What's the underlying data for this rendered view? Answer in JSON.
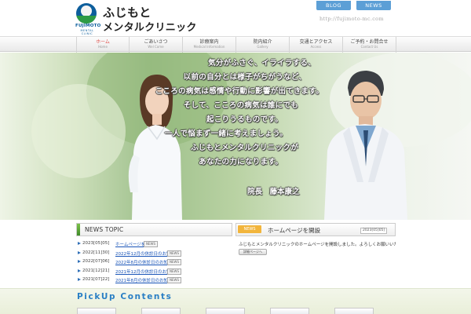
{
  "header": {
    "logo_jp_line1": "ふじもと",
    "logo_jp_line2": "メンタルクリニック",
    "logo_en": "FUJIMOTO",
    "logo_en_sub": "MENTAL CLINIC",
    "blog_label": "BLOG",
    "news_label": "NEWS",
    "site_url": "http://fujimoto-mc.com"
  },
  "nav": {
    "items": [
      {
        "jp": "ホーム",
        "en": "Home"
      },
      {
        "jp": "ごあいさつ",
        "en": "Wel Come"
      },
      {
        "jp": "診療案内",
        "en": "Medical Information"
      },
      {
        "jp": "院内紹介",
        "en": "Gallery"
      },
      {
        "jp": "交通とアクセス",
        "en": "Access"
      },
      {
        "jp": "ご予約・お問合せ",
        "en": "Contact Us"
      }
    ]
  },
  "hero": {
    "lines": [
      "気分がふさぐ、イライラする、",
      "以前の自分とは様子がちがうなど、",
      "こころの病気は感情や行動に影響が出てきます。",
      "そして、こころの病気は誰にでも",
      "起こりうるものです。",
      "一人で悩まず一緒に考えましょう。",
      "ふじもとメンタルクリニックが",
      "あなたの力になります。"
    ],
    "signature": "院長　藤本康之"
  },
  "news_topic": {
    "title": "NEWS TOPIC",
    "items": [
      {
        "date": "2023[05]05]",
        "title": "ホームページを開設",
        "badge": "NEWS"
      },
      {
        "date": "2022[11]30]",
        "title": "2022年12月の休診日のお知...",
        "badge": "NEWS"
      },
      {
        "date": "2022[07]06]",
        "title": "2022年8月の休診日のお知...",
        "badge": "NEWS"
      },
      {
        "date": "2021[12]21]",
        "title": "2021年12月の休診日のお知...",
        "badge": "NEWS"
      },
      {
        "date": "2021[07]22]",
        "title": "2021年8月の休診日のお知...",
        "badge": "NEWS"
      }
    ]
  },
  "featured": {
    "tag": "NEWS",
    "title": "ホームページを開設",
    "date": "2023[05]05]",
    "body": "ふじもとメンタルクリニックのホームページを開設しました。よろしくお願いいたします。",
    "more_label": "詳細ページへ"
  },
  "pickup": {
    "title": "PickUp Contents"
  },
  "colors": {
    "brand_blue": "#0d5e9c",
    "brand_green": "#2e9b45",
    "nav_active": "#e0524e",
    "link_blue": "#1a55b8",
    "pickup_title": "#2a7fc5",
    "button_blue": "#5c9fd6",
    "news_tag": "#f2b53c"
  }
}
